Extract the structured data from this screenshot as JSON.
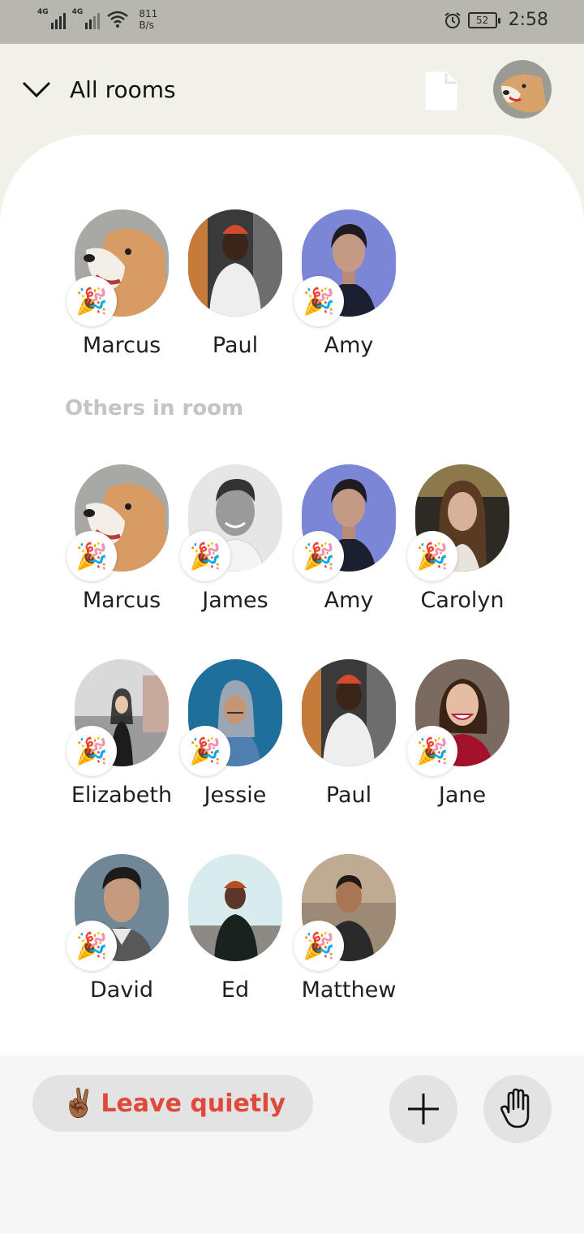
{
  "status_bar": {
    "network_1": "4G",
    "network_2": "4G",
    "speed_value": "811",
    "speed_unit": "B/s",
    "battery": "52",
    "time": "2:58"
  },
  "header": {
    "title": "All rooms",
    "icons": [
      "chevron-down-icon",
      "document-icon"
    ]
  },
  "speakers": [
    {
      "name": "Marcus",
      "badge": "🎉",
      "photo": "dog"
    },
    {
      "name": "Paul",
      "badge": "",
      "photo": "paul"
    },
    {
      "name": "Amy",
      "badge": "🎉",
      "photo": "amy"
    }
  ],
  "others_label": "Others in room",
  "others": [
    {
      "name": "Marcus",
      "badge": "🎉",
      "photo": "dog"
    },
    {
      "name": "James",
      "badge": "🎉",
      "photo": "james"
    },
    {
      "name": "Amy",
      "badge": "🎉",
      "photo": "amy"
    },
    {
      "name": "Carolyn",
      "badge": "🎉",
      "photo": "carolyn"
    },
    {
      "name": "Elizabeth",
      "badge": "🎉",
      "photo": "elizabeth"
    },
    {
      "name": "Jessie",
      "badge": "🎉",
      "photo": "jessie"
    },
    {
      "name": "Paul",
      "badge": "",
      "photo": "paul"
    },
    {
      "name": "Jane",
      "badge": "🎉",
      "photo": "jane"
    },
    {
      "name": "David",
      "badge": "🎉",
      "photo": "david"
    },
    {
      "name": "Ed",
      "badge": "",
      "photo": "ed"
    },
    {
      "name": "Matthew",
      "badge": "🎉",
      "photo": "matthew"
    }
  ],
  "bottom_bar": {
    "leave_emoji": "✌🏾",
    "leave_label": "Leave quietly",
    "add_icon": "plus-icon",
    "hand_icon": "raise-hand-icon"
  },
  "colors": {
    "header_bg": "#f2f1e8",
    "leave_text": "#e0483a",
    "section_label": "#c4c4c4"
  }
}
